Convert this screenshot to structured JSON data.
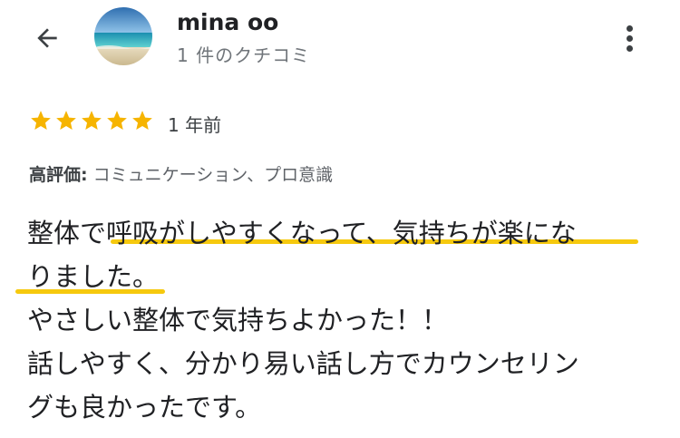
{
  "header": {
    "name": "mina oo",
    "review_count": "1 件のクチコミ",
    "back_icon": "arrow-left-icon",
    "more_icon": "more-vert-icon"
  },
  "review": {
    "rating": 5,
    "max_rating": 5,
    "time_ago": "1 年前",
    "highlights_label": "高評価:",
    "highlights_value": "コミュニケーション、プロ意識",
    "lines": [
      "整体で呼吸がしやすくなって、気持ちが楽にな",
      "りました。",
      "やさしい整体で気持ちよかった！！",
      "話しやすく、分かり易い話し方でカウンセリン",
      "グも良かったです。"
    ]
  },
  "colors": {
    "star": "#f6b400",
    "underline": "#f6c90e",
    "text": "#202124",
    "secondary_text": "#70757a"
  }
}
